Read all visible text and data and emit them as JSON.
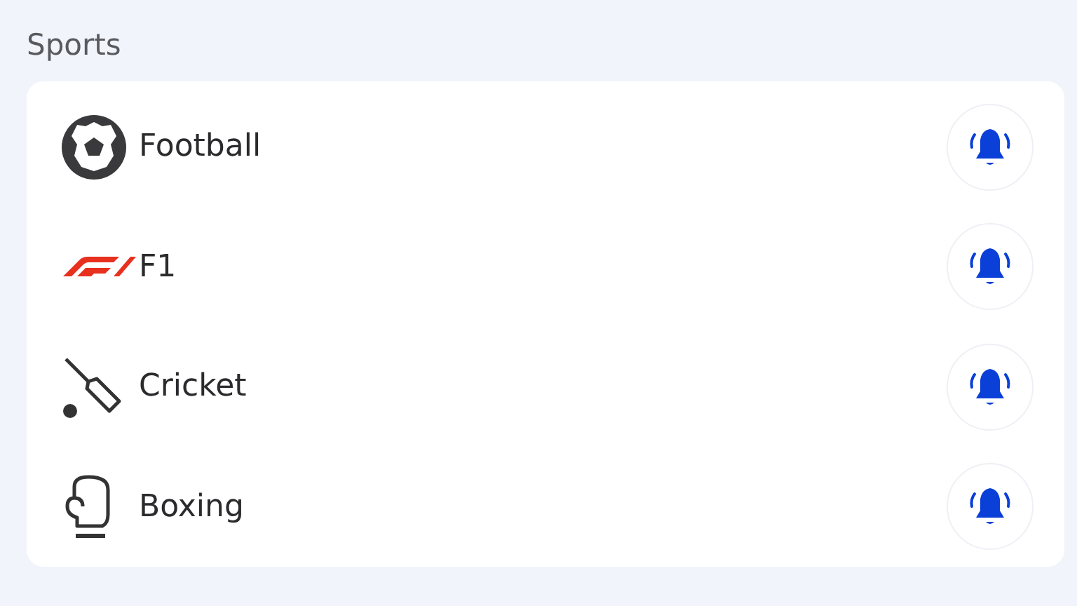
{
  "section_title": "Sports",
  "sports": [
    {
      "kind": "football",
      "name": "Football",
      "notify_on": true
    },
    {
      "kind": "f1",
      "name": "F1",
      "notify_on": true
    },
    {
      "kind": "cricket",
      "name": "Cricket",
      "notify_on": true
    },
    {
      "kind": "boxing",
      "name": "Boxing",
      "notify_on": true
    }
  ]
}
